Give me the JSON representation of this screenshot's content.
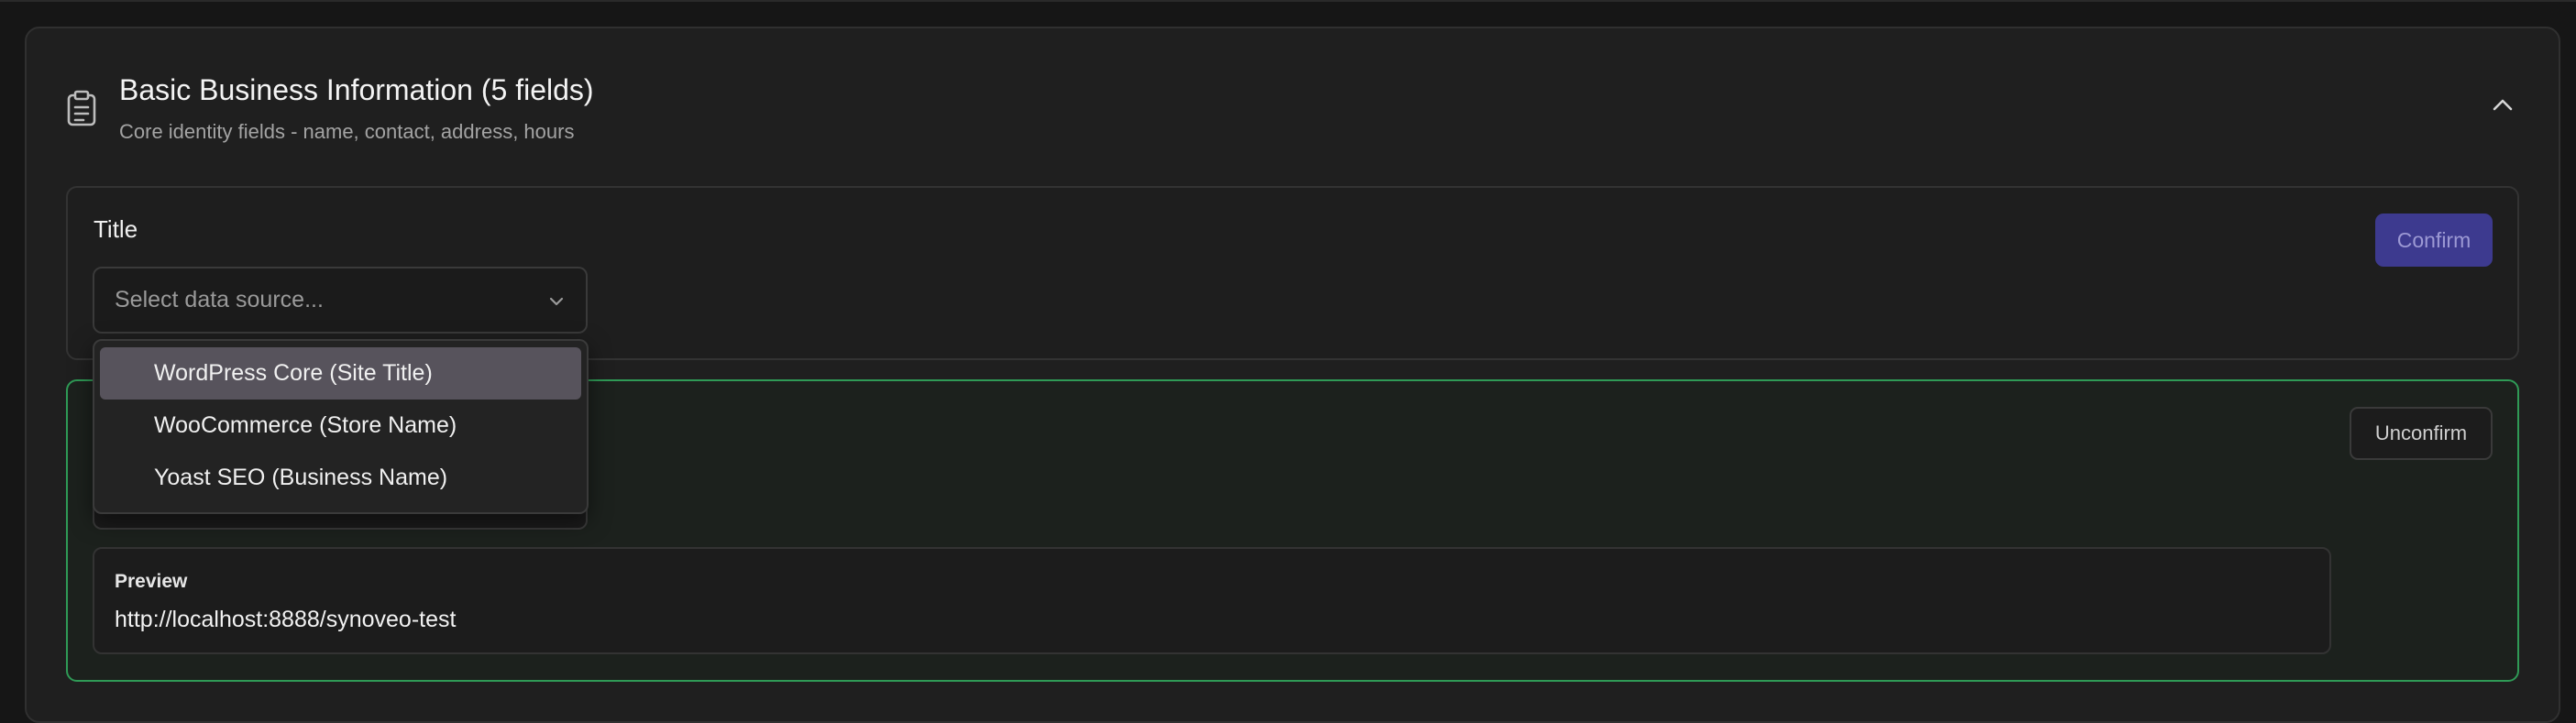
{
  "section": {
    "icon": "clipboard-icon",
    "title": "Basic Business Information (5 fields)",
    "subtitle": "Core identity fields - name, contact, address, hours",
    "collapse_icon": "chevron-up-icon"
  },
  "title_field": {
    "label": "Title",
    "select_placeholder": "Select data source...",
    "select_icon": "chevron-down-icon",
    "confirm_label": "Confirm"
  },
  "dropdown": {
    "options": [
      "WordPress Core (Site Title)",
      "WooCommerce (Store Name)",
      "Yoast SEO (Business Name)"
    ],
    "highlighted_index": 0
  },
  "confirmed_field": {
    "unconfirm_label": "Unconfirm",
    "preview_label": "Preview",
    "preview_value": "http://localhost:8888/synoveo-test"
  },
  "colors": {
    "accent_confirm": "#3d3a8f",
    "confirmed_border": "#2f9a56",
    "highlight": "#57535c"
  }
}
